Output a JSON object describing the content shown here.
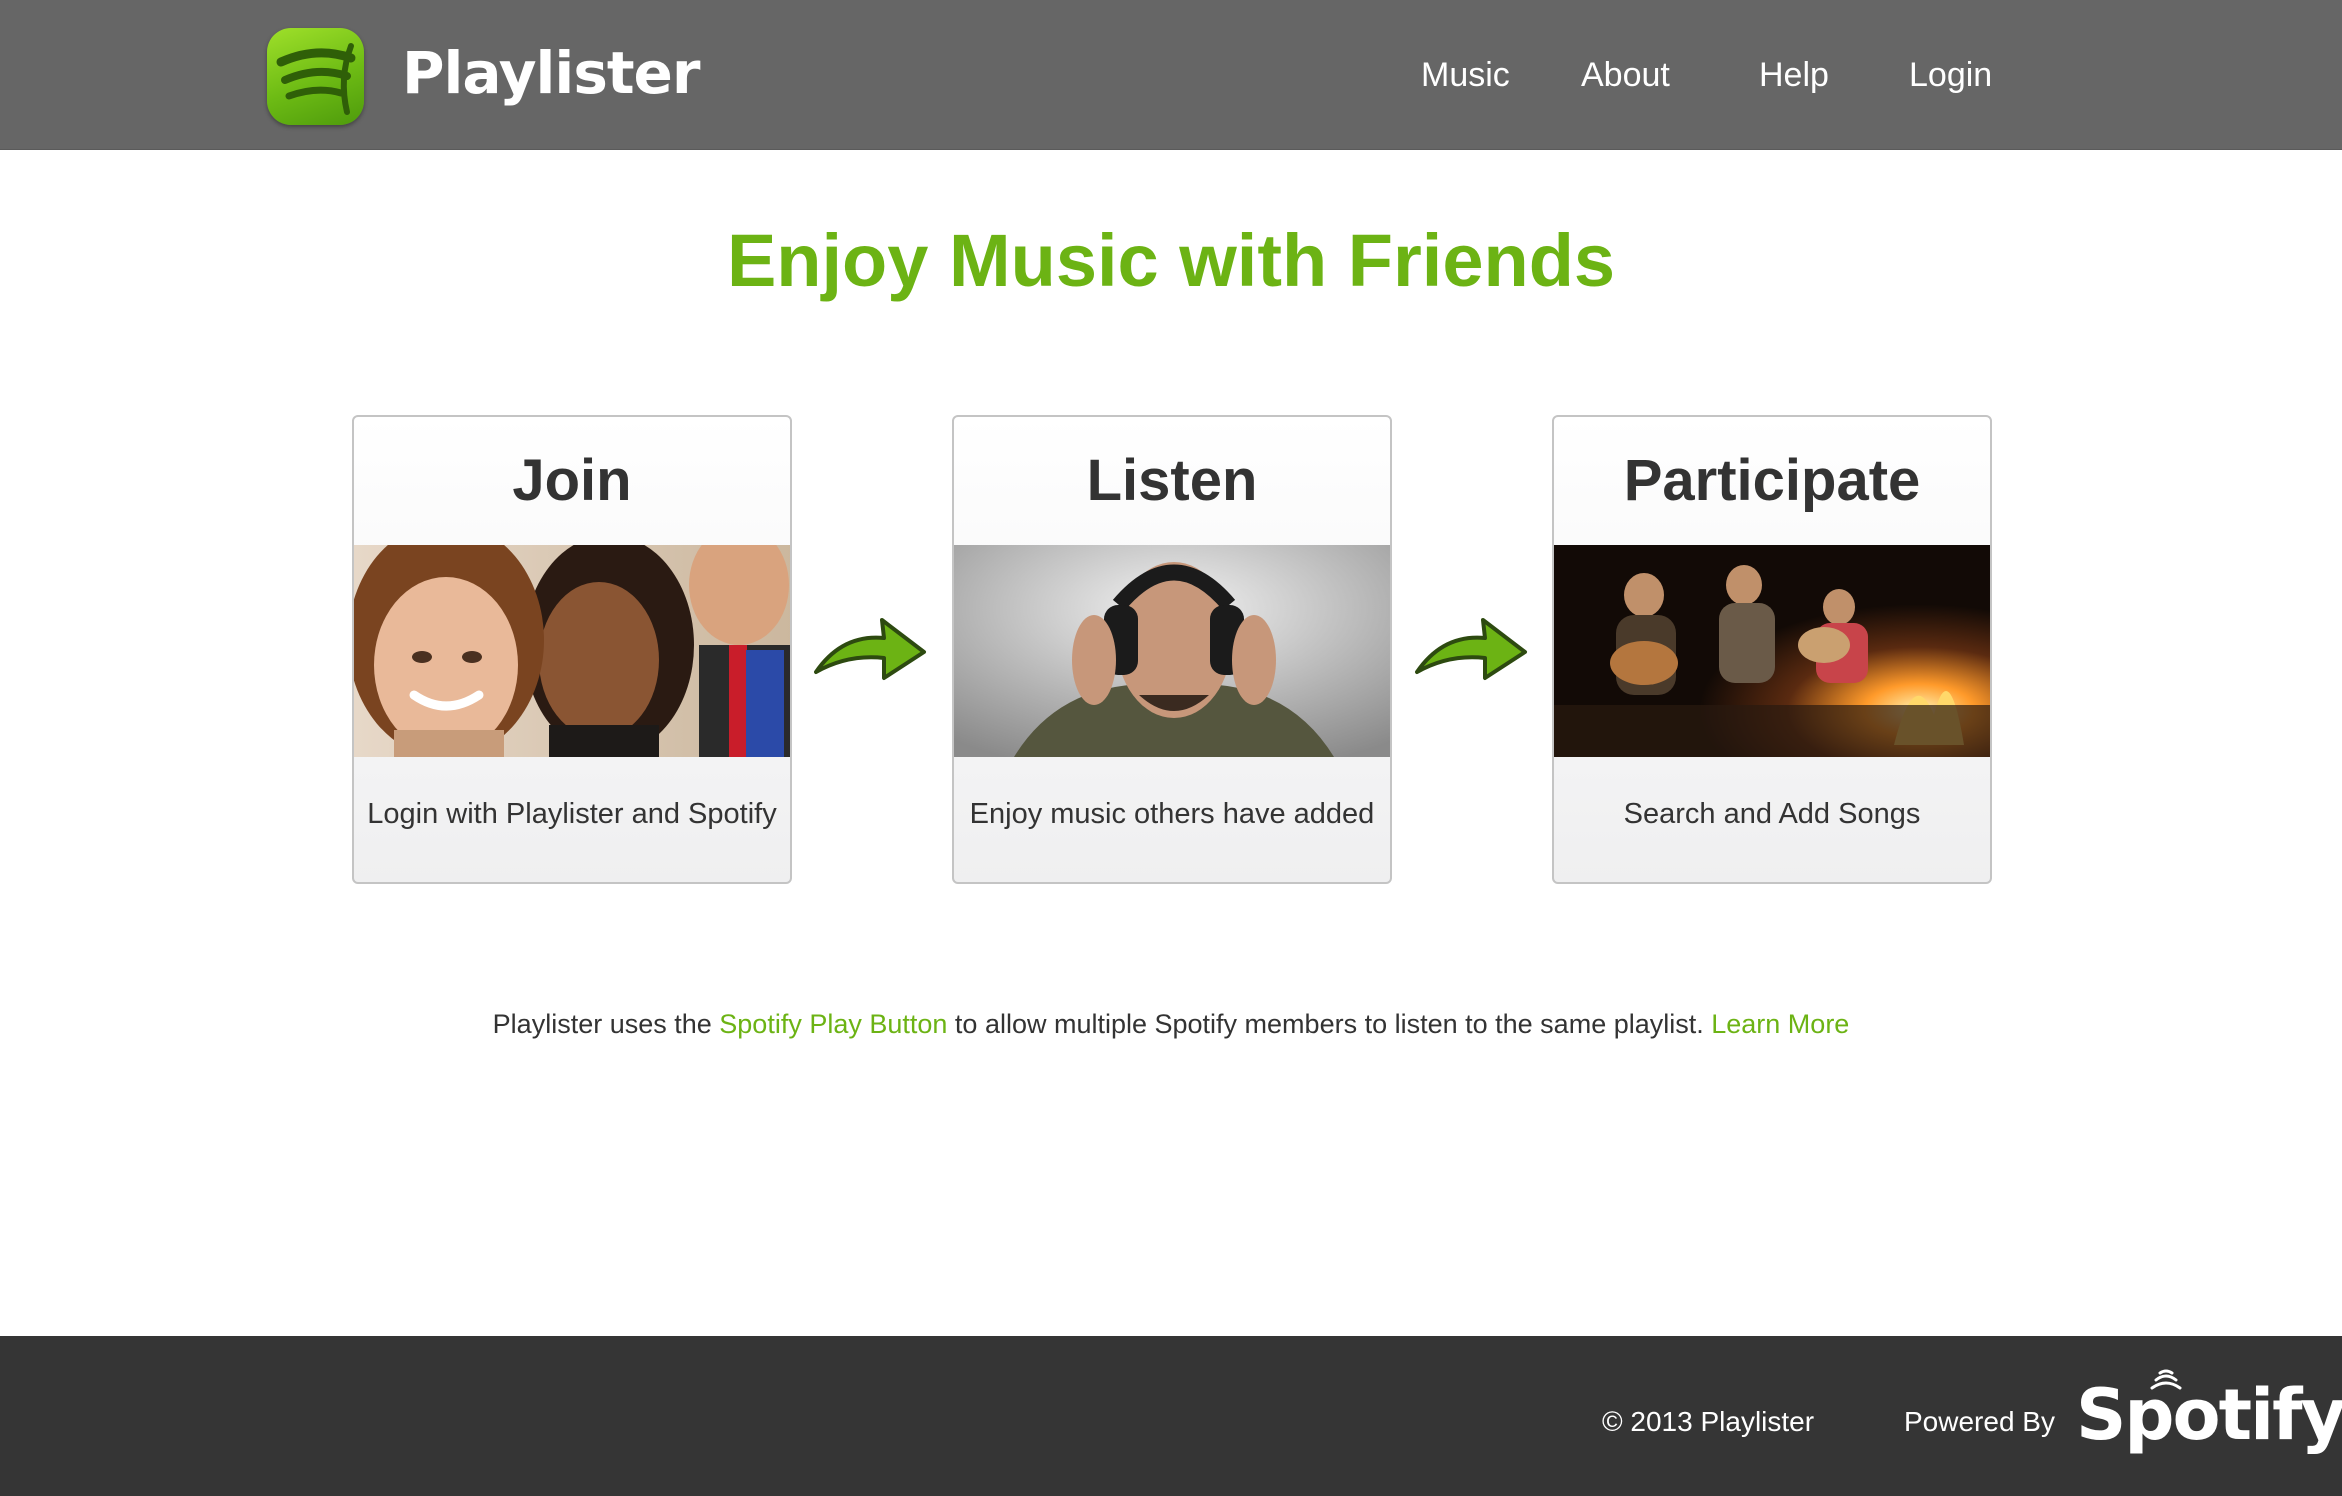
{
  "header": {
    "brand": "Playlister",
    "nav": [
      "Music",
      "About",
      "Help",
      "Login"
    ]
  },
  "hero": {
    "headline": "Enjoy Music with Friends"
  },
  "cards": [
    {
      "title": "Join",
      "caption": "Login with Playlister and Spotify"
    },
    {
      "title": "Listen",
      "caption": "Enjoy music others have added"
    },
    {
      "title": "Participate",
      "caption": "Search and Add Songs"
    }
  ],
  "info": {
    "text1": "Playlister uses the ",
    "link1": "Spotify Play Button",
    "text2": " to allow multiple Spotify members to listen to the same playlist. ",
    "link2": "Learn More"
  },
  "footer": {
    "copyright": "© 2013 Playlister",
    "powered_by": "Powered By",
    "spotify_logo_text": "Spotify"
  },
  "colors": {
    "accent": "#6cb314",
    "header_bg": "#666666",
    "footer_bg": "#353535"
  }
}
